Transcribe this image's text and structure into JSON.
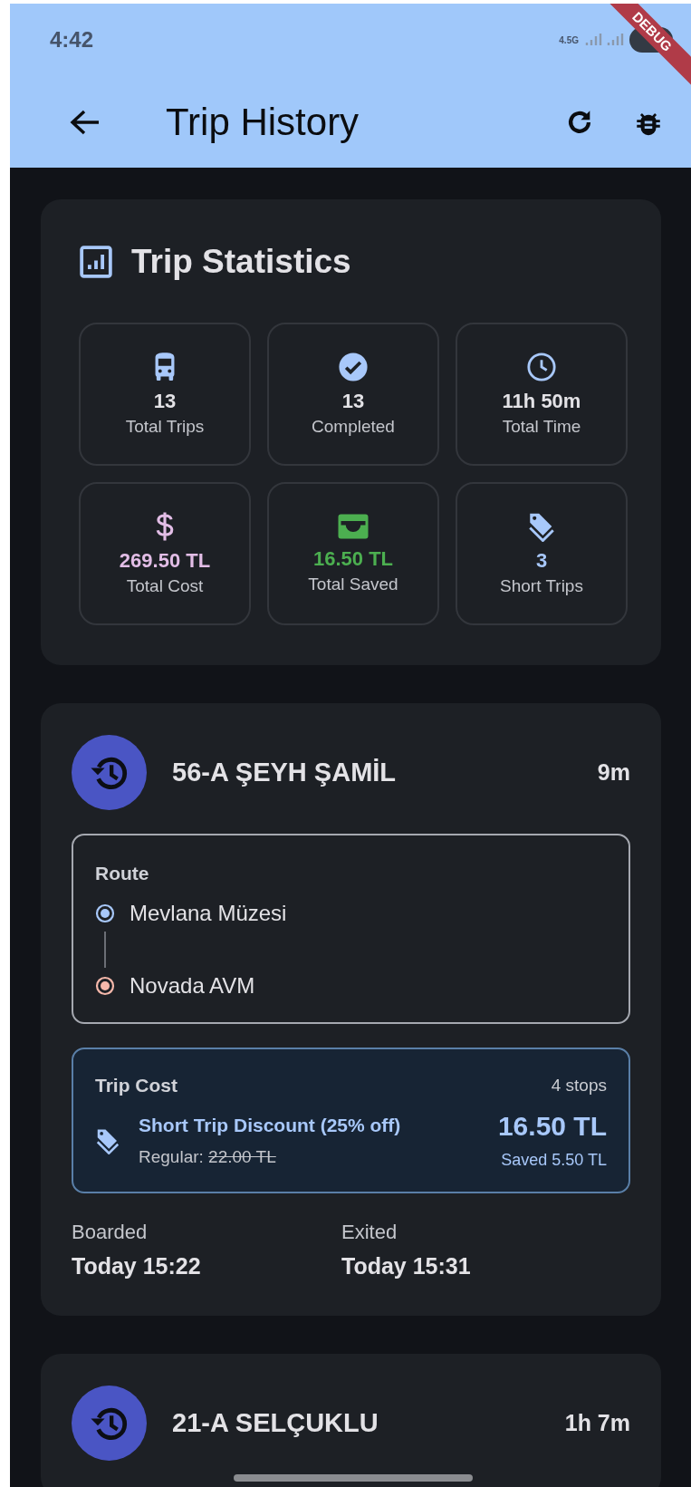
{
  "status_bar": {
    "time": "4:42",
    "network": "4.5G"
  },
  "debug_banner": "DEBUG",
  "app_bar": {
    "title": "Trip History"
  },
  "stats": {
    "title": "Trip Statistics",
    "tiles": [
      {
        "kind": "bus",
        "value": "13",
        "label": "Total Trips",
        "color": "#a8c8fa",
        "highlight": false
      },
      {
        "kind": "check",
        "value": "13",
        "label": "Completed",
        "color": "#a8c8fa",
        "highlight": false
      },
      {
        "kind": "clock",
        "value": "11h 50m",
        "label": "Total Time",
        "color": "#a8c8fa",
        "highlight": false
      },
      {
        "kind": "dollar",
        "value": "269.50 TL",
        "label": "Total Cost",
        "color": "#e2bde6",
        "highlight": true
      },
      {
        "kind": "wallet",
        "value": "16.50 TL",
        "label": "Total Saved",
        "color": "#4caf50",
        "highlight": true
      },
      {
        "kind": "tag",
        "value": "3",
        "label": "Short Trips",
        "color": "#a8c8fa",
        "highlight": true
      }
    ]
  },
  "trips": [
    {
      "route": "56-A ŞEYH ŞAMİL",
      "duration": "9m",
      "route_label": "Route",
      "stops": [
        {
          "name": "Mevlana Müzesi",
          "kind": "origin"
        },
        {
          "name": "Novada AVM",
          "kind": "destination"
        }
      ],
      "cost": {
        "title": "Trip Cost",
        "stops": "4 stops",
        "discount": "Short Trip Discount (25% off)",
        "regular_label": "Regular:",
        "regular": "22.00 TL",
        "price": "16.50 TL",
        "saved": "Saved 5.50 TL"
      },
      "boarded_label": "Boarded",
      "boarded": "Today 15:22",
      "exited_label": "Exited",
      "exited": "Today 15:31"
    },
    {
      "route": "21-A SELÇUKLU",
      "duration": "1h 7m"
    }
  ]
}
